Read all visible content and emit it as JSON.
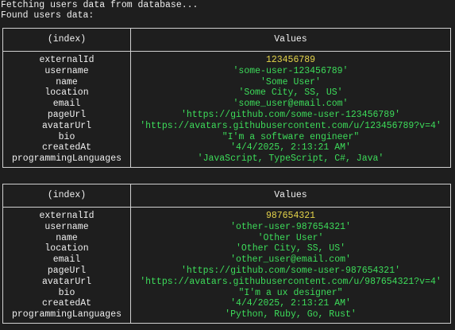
{
  "console": {
    "line1": "Fetching users data from database...",
    "line2": "Found users data:"
  },
  "table_headers": {
    "index": "(index)",
    "values": "Values"
  },
  "colors": {
    "background": "#1e1e1e",
    "string_value": "#3ddc5a",
    "number_value": "#e5d44a",
    "text": "#f0f0f0"
  },
  "users": [
    {
      "rows": [
        {
          "key": "externalId",
          "value": "123456789",
          "type": "number"
        },
        {
          "key": "username",
          "value": "'some-user-123456789'",
          "type": "string"
        },
        {
          "key": "name",
          "value": "'Some User'",
          "type": "string"
        },
        {
          "key": "location",
          "value": "'Some City, SS, US'",
          "type": "string"
        },
        {
          "key": "email",
          "value": "'some_user@email.com'",
          "type": "string"
        },
        {
          "key": "pageUrl",
          "value": "'https://github.com/some-user-123456789'",
          "type": "string"
        },
        {
          "key": "avatarUrl",
          "value": "'https://avatars.githubusercontent.com/u/123456789?v=4'",
          "type": "string"
        },
        {
          "key": "bio",
          "value": "\"I'm a software engineer\"",
          "type": "string"
        },
        {
          "key": "createdAt",
          "value": "'4/4/2025, 2:13:21 AM'",
          "type": "string"
        },
        {
          "key": "programmingLanguages",
          "value": "'JavaScript, TypeScript, C#, Java'",
          "type": "string"
        }
      ]
    },
    {
      "rows": [
        {
          "key": "externalId",
          "value": "987654321",
          "type": "number"
        },
        {
          "key": "username",
          "value": "'other-user-987654321'",
          "type": "string"
        },
        {
          "key": "name",
          "value": "'Other User'",
          "type": "string"
        },
        {
          "key": "location",
          "value": "'Other City, SS, US'",
          "type": "string"
        },
        {
          "key": "email",
          "value": "'other_user@email.com'",
          "type": "string"
        },
        {
          "key": "pageUrl",
          "value": "'https://github.com/some-user-987654321'",
          "type": "string"
        },
        {
          "key": "avatarUrl",
          "value": "'https://avatars.githubusercontent.com/u/987654321?v=4'",
          "type": "string"
        },
        {
          "key": "bio",
          "value": "\"I'm a ux designer\"",
          "type": "string"
        },
        {
          "key": "createdAt",
          "value": "'4/4/2025, 2:13:21 AM'",
          "type": "string"
        },
        {
          "key": "programmingLanguages",
          "value": "'Python, Ruby, Go, Rust'",
          "type": "string"
        }
      ]
    }
  ]
}
